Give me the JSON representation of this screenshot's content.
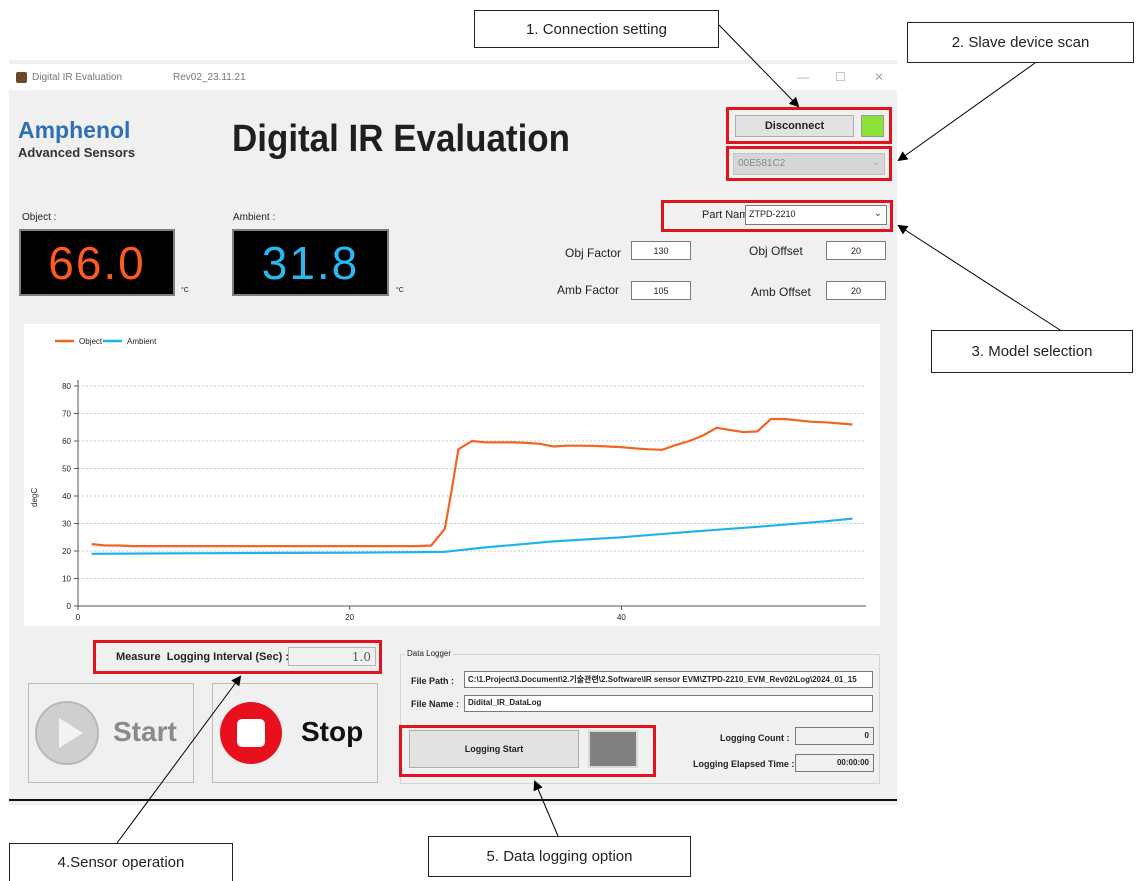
{
  "window": {
    "title": "Digital IR Evaluation",
    "version": "Rev02_23.11.21",
    "min_symbol": "—",
    "max_symbol": "☐",
    "close_symbol": "✕"
  },
  "logo": {
    "line1": "Amphenol",
    "line2": "Advanced Sensors"
  },
  "app_title": "Digital IR Evaluation",
  "connection": {
    "button_label": "Disconnect",
    "status_color": "#8de23a"
  },
  "slave_device": {
    "selected": "00E581C2"
  },
  "readouts": {
    "object_label": "Object :",
    "object_value": "66.0",
    "object_unit": "°C",
    "object_color": "#ff5a1f",
    "ambient_label": "Ambient :",
    "ambient_value": "31.8",
    "ambient_unit": "°C",
    "ambient_color": "#2ab8f0"
  },
  "model": {
    "part_name_label": "Part Name :",
    "part_name_value": "ZTPD-2210",
    "obj_factor_label": "Obj Factor",
    "obj_factor_value": "130",
    "obj_offset_label": "Obj Offset",
    "obj_offset_value": "20",
    "amb_factor_label": "Amb Factor",
    "amb_factor_value": "105",
    "amb_offset_label": "Amb Offset",
    "amb_offset_value": "20"
  },
  "chart_data": {
    "type": "line",
    "title": "",
    "xlabel": "",
    "ylabel": "degC",
    "xlim": [
      0,
      58
    ],
    "ylim": [
      0,
      80
    ],
    "x_ticks": [
      0,
      20,
      40
    ],
    "y_ticks": [
      0,
      10,
      20,
      30,
      40,
      50,
      60,
      70,
      80
    ],
    "grid": true,
    "legend": "top-left",
    "series": [
      {
        "name": "Object",
        "color": "#f26522",
        "x": [
          1,
          2,
          3,
          4,
          5,
          6,
          7,
          8,
          9,
          10,
          11,
          12,
          13,
          14,
          15,
          16,
          17,
          18,
          19,
          20,
          21,
          22,
          23,
          24,
          25,
          26,
          27,
          27.5,
          28,
          29,
          30,
          31,
          32,
          33,
          34,
          35,
          36,
          37,
          38,
          39,
          40,
          41,
          42,
          43,
          44,
          45,
          46,
          47,
          48,
          49,
          50,
          51,
          52,
          53,
          54,
          55,
          56,
          57
        ],
        "values": [
          22.5,
          22,
          22,
          21.8,
          21.8,
          21.8,
          21.8,
          21.8,
          21.8,
          21.8,
          21.8,
          21.8,
          21.8,
          21.8,
          21.8,
          21.8,
          21.8,
          21.8,
          21.8,
          21.8,
          21.8,
          21.8,
          21.8,
          21.8,
          21.8,
          22,
          28,
          42,
          57,
          60,
          59.5,
          59.5,
          59.5,
          59.3,
          59,
          58,
          58.3,
          58.3,
          58.2,
          58,
          57.8,
          57.3,
          57,
          56.8,
          58.5,
          60,
          62,
          64.8,
          64,
          63.2,
          63.5,
          68,
          68,
          67.5,
          67,
          66.8,
          66.4,
          66
        ]
      },
      {
        "name": "Ambient",
        "color": "#1eb4ea",
        "x": [
          1,
          5,
          10,
          15,
          20,
          25,
          27,
          30,
          35,
          40,
          45,
          50,
          55,
          57
        ],
        "values": [
          19,
          19.1,
          19.2,
          19.3,
          19.4,
          19.6,
          19.7,
          21.3,
          23.5,
          25,
          27,
          28.8,
          30.8,
          31.8
        ]
      }
    ]
  },
  "interval": {
    "label": "Measure  Logging Interval (Sec) :",
    "value": "1.0"
  },
  "controls": {
    "start_label": "Start",
    "stop_label": "Stop"
  },
  "logger": {
    "group_label": "Data Logger",
    "file_path_label": "File Path :",
    "file_path_value": "C:\\1.Project\\3.Document\\2.기술관련\\2.Software\\IR sensor EVM\\ZTPD-2210_EVM_Rev02\\Log\\2024_01_15",
    "file_name_label": "File Name :",
    "file_name_value": "Didital_IR_DataLog",
    "logging_button": "Logging Start",
    "count_label": "Logging Count :",
    "count_value": "0",
    "elapsed_label": "Logging Elapsed Time :",
    "elapsed_value": "00:00:00"
  },
  "callouts": {
    "c1": "1. Connection setting",
    "c2": "2. Slave device scan",
    "c3": "3. Model selection",
    "c4": "4.Sensor operation",
    "c5": "5. Data logging option"
  }
}
